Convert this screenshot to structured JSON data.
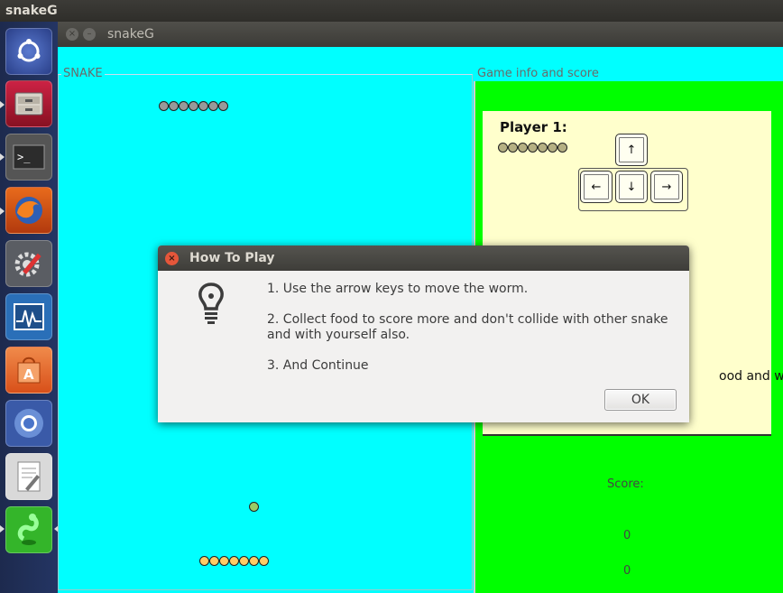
{
  "top_panel": {
    "app_name": "snakeG"
  },
  "launcher": {
    "items": [
      {
        "name": "ubuntu-dash-icon"
      },
      {
        "name": "files-icon"
      },
      {
        "name": "terminal-icon"
      },
      {
        "name": "firefox-icon"
      },
      {
        "name": "settings-icon"
      },
      {
        "name": "system-monitor-icon"
      },
      {
        "name": "software-center-icon"
      },
      {
        "name": "chromium-icon"
      },
      {
        "name": "text-editor-icon"
      },
      {
        "name": "snakeg-app-icon"
      }
    ]
  },
  "window": {
    "title": "snakeG",
    "close_glyph": "×",
    "minimize_glyph": "–"
  },
  "game": {
    "panel_label": "SNAKE",
    "snake_top_color": "#999999",
    "snake_bottom_color": "#ffcc66",
    "food_color": "#99cc66"
  },
  "info": {
    "panel_label": "Game info and score",
    "player_label": "Player 1:",
    "keys": {
      "up": "↑",
      "left": "←",
      "down": "↓",
      "right": "→"
    },
    "win_text": "ood and win.",
    "score_label": "Score:",
    "score_1": "0",
    "score_2": "0"
  },
  "dialog": {
    "title": "How To Play",
    "close_glyph": "×",
    "line1": "1. Use the arrow keys to move the worm.",
    "line2a": "2. Collect food to score more and don't collide with other snake",
    "line2b": "and with yourself also.",
    "line3": "3. And Continue",
    "ok_label": "OK"
  },
  "colors": {
    "game_bg": "#00ffff",
    "info_bg": "#00ff00",
    "card_bg": "#ffffcc"
  }
}
